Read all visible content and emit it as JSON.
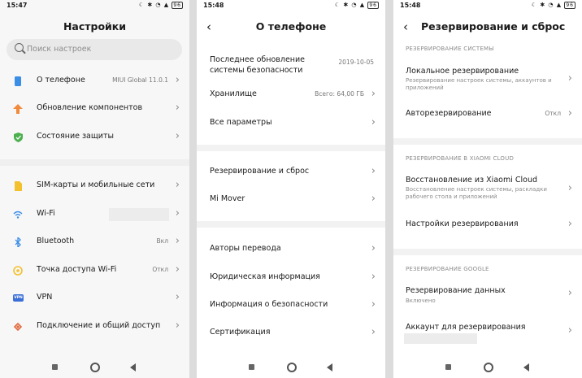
{
  "screen1": {
    "status_time": "15:47",
    "battery": "96",
    "title": "Настройки",
    "search_placeholder": "Поиск настроек",
    "items": [
      {
        "label": "О телефоне",
        "value": "MIUI Global 11.0.1"
      },
      {
        "label": "Обновление компонентов",
        "value": ""
      },
      {
        "label": "Состояние защиты",
        "value": ""
      },
      {
        "label": "SIM-карты и мобильные сети",
        "value": ""
      },
      {
        "label": "Wi-Fi",
        "value": ""
      },
      {
        "label": "Bluetooth",
        "value": "Вкл"
      },
      {
        "label": "Точка доступа Wi-Fi",
        "value": "Откл"
      },
      {
        "label": "VPN",
        "value": ""
      },
      {
        "label": "Подключение и общий доступ",
        "value": ""
      }
    ],
    "vpn_badge": "VPN"
  },
  "screen2": {
    "status_time": "15:48",
    "battery": "96",
    "title": "О телефоне",
    "items": [
      {
        "label": "Последнее обновление системы безопасности",
        "value": "2019-10-05"
      },
      {
        "label": "Хранилище",
        "value": "Всего: 64,00 ГБ"
      },
      {
        "label": "Все параметры",
        "value": ""
      },
      {
        "label": "Резервирование и сброс",
        "value": ""
      },
      {
        "label": "Mi Mover",
        "value": ""
      },
      {
        "label": "Авторы перевода",
        "value": ""
      },
      {
        "label": "Юридическая информация",
        "value": ""
      },
      {
        "label": "Информация о безопасности",
        "value": ""
      },
      {
        "label": "Сертификация",
        "value": ""
      }
    ]
  },
  "screen3": {
    "status_time": "15:48",
    "battery": "96",
    "title": "Резервирование и сброс",
    "section1": "РЕЗЕРВИРОВАНИЕ СИСТЕМЫ",
    "local_label": "Локальное резервирование",
    "local_sub": "Резервирование настроек системы, аккаунтов и приложений",
    "auto_label": "Авторезервирование",
    "auto_value": "Откл",
    "section2": "РЕЗЕРВИРОВАНИЕ В XIAOMI CLOUD",
    "restore_label": "Восстановление из Xiaomi Cloud",
    "restore_sub": "Восстановление настроек системы, раскладки рабочего стола и приложений",
    "settings_label": "Настройки резервирования",
    "section3": "РЕЗЕРВИРОВАНИЕ GOOGLE",
    "data_label": "Резервирование данных",
    "data_sub": "Включено",
    "account_label": "Аккаунт для резервирования"
  },
  "colors": {
    "orange": "#f08a3c",
    "green": "#4cb050",
    "blue": "#3a8ee6",
    "yellow": "#f3c02e"
  }
}
